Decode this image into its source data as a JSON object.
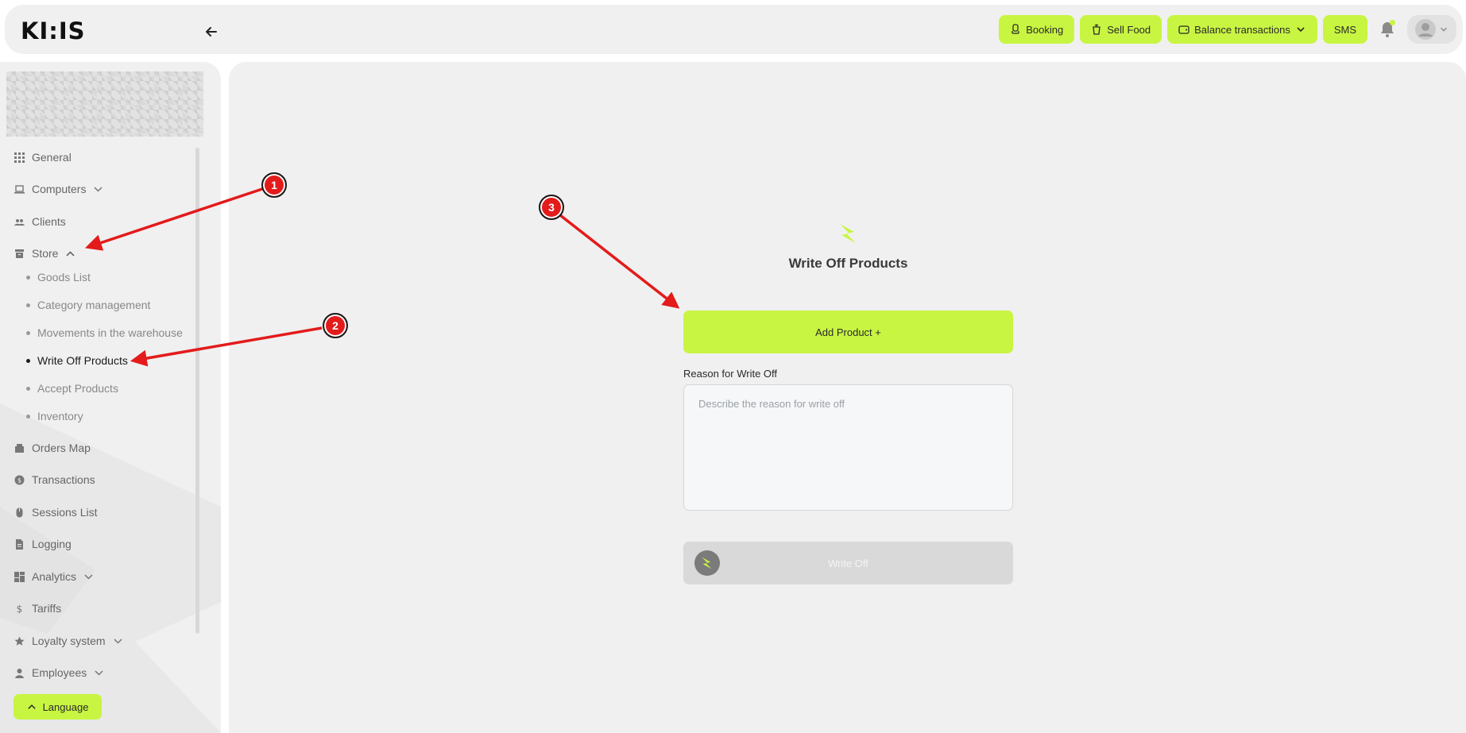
{
  "header": {
    "logo_text": "KI:IS",
    "actions": {
      "booking": "Booking",
      "sell_food": "Sell Food",
      "balance_transactions": "Balance transactions",
      "sms": "SMS"
    }
  },
  "sidebar": {
    "items": {
      "general": "General",
      "computers": "Computers",
      "clients": "Clients",
      "store": "Store",
      "orders_map": "Orders Map",
      "transactions": "Transactions",
      "sessions_list": "Sessions List",
      "logging": "Logging",
      "analytics": "Analytics",
      "tariffs": "Tariffs",
      "loyalty_system": "Loyalty system",
      "employees": "Employees"
    },
    "store_sub": {
      "goods_list": "Goods List",
      "category_management": "Category management",
      "movements": "Movements in the warehouse",
      "write_off_products": "Write Off Products",
      "accept_products": "Accept Products",
      "inventory": "Inventory"
    },
    "language_button": "Language"
  },
  "form": {
    "title": "Write Off Products",
    "add_product_button": "Add Product +",
    "reason_label": "Reason for Write Off",
    "reason_placeholder": "Describe the reason for write off",
    "reason_value": "",
    "submit_button": "Write Off"
  },
  "annotations": {
    "marker_1": "1",
    "marker_2": "2",
    "marker_3": "3"
  },
  "colors": {
    "accent": "#c8f542",
    "annotation": "#e31b1b",
    "background": "#f0f0f0"
  }
}
